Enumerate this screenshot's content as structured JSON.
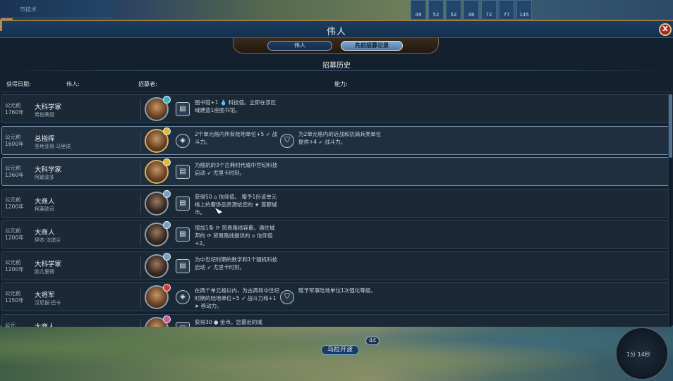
{
  "top_hint": "市技术",
  "top_stats": [
    "49",
    "52",
    "52",
    "36",
    "72",
    "77",
    "145"
  ],
  "panel": {
    "title": "伟人",
    "close_label": "X",
    "tabs": [
      {
        "label": "伟人",
        "selected": false
      },
      {
        "label": "先前招募记录",
        "selected": true
      }
    ],
    "subtitle": "招募历史",
    "columns": {
      "date": "获得日期:",
      "person": "伟人:",
      "recruiter": "招募者:",
      "ability": "能力:"
    }
  },
  "rows": [
    {
      "era": "公元前1760年",
      "type": "大科学家",
      "name": "希帕蒂娅",
      "highlight": false,
      "ability_icon": "scroll-icon",
      "ability": "图书馆+1 💧 科技值。立即在该区域建造1座图书馆。",
      "ability2": "",
      "badge_color": "#39b4c8"
    },
    {
      "era": "公元前1600年",
      "type": "总指挥",
      "name": "圣地亚哥·马里诺",
      "highlight": true,
      "ability_icon": "compass-icon",
      "ability": "2个单元格内所有陆地单位+5 ➶ 战斗力。",
      "ability2": "为2单元格内的近战和抗骑兵类单位提供+4 ➶ 战斗力。",
      "badge_color": "#e0b83a"
    },
    {
      "era": "公元前1360年",
      "type": "大科学家",
      "name": "阿耶波多",
      "highlight": true,
      "ability_icon": "scroll-icon",
      "ability": "为随机的3个古典时代或中世纪科技启动 ➶ 尤里卡时刻。",
      "ability2": "",
      "badge_color": "#e0b83a"
    },
    {
      "era": "公元前1200年",
      "type": "大商人",
      "name": "柯莱欧司",
      "highlight": false,
      "ability_icon": "scroll-icon",
      "ability": "获得50 ⌂ 信仰值。 赠予1份该单元格上的奢侈品资源给您的 ★ 首都城市。",
      "ability2": "",
      "badge_color": "#7a9ec2"
    },
    {
      "era": "公元前1200年",
      "type": "大商人",
      "name": "伊本·法提兰",
      "highlight": false,
      "ability_icon": "scroll-icon",
      "ability": "增加1条 ⟳ 贸易路线容量。通往城邦的 ⟳ 贸易路线提供的 ⌂ 信仰值+2。",
      "ability2": "",
      "badge_color": "#7a9ec2"
    },
    {
      "era": "公元前1200年",
      "type": "大科学家",
      "name": "欧几里得",
      "highlight": false,
      "ability_icon": "scroll-icon",
      "ability": "为中世纪时期的数学和1个随机科技启动 ➶ 尤里卡时刻。",
      "ability2": "",
      "badge_color": "#7a9ec2"
    },
    {
      "era": "公元前1150年",
      "type": "大将军",
      "name": "汉尼拔·巴卡",
      "highlight": false,
      "ability_icon": "compass-icon",
      "ability": "在两个单元格以内，为古典和中世纪时期的陆地单位+5 ➶ 战斗力和+1 ➤ 移动力。",
      "ability2": "赠予军事陆地单位1次强化等级。",
      "badge_color": "#d93a2e"
    },
    {
      "era": "公元",
      "type": "大商人",
      "name": "",
      "highlight": false,
      "ability_icon": "scroll-icon",
      "ability": "获得30 ● 金币。您最近的城",
      "ability2": "",
      "badge_color": "#c95aa0"
    }
  ],
  "map": {
    "city_name": "乌拉开波",
    "pop": "44",
    "clock": "1分 14秒"
  },
  "colors": {
    "accent": "#7fa9d0",
    "frame": "#a07a45",
    "close": "#c33d2e"
  }
}
